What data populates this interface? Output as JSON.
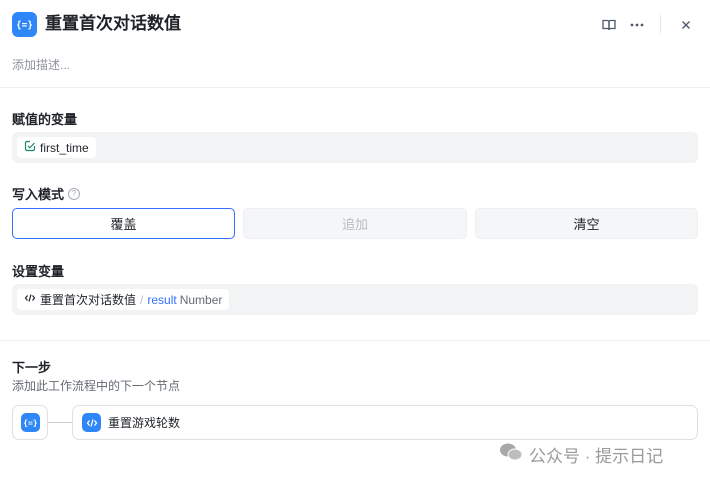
{
  "header": {
    "title": "重置首次对话数值",
    "icon": "variable-assign-icon",
    "description_placeholder": "添加描述..."
  },
  "assigned_variable": {
    "label": "赋值的变量",
    "chip_icon": "variable-icon",
    "value": "first_time"
  },
  "write_mode": {
    "label": "写入模式",
    "help_icon": "question-circle-icon",
    "options": [
      "覆盖",
      "追加",
      "清空"
    ],
    "selected": "覆盖",
    "disabled": [
      "追加"
    ]
  },
  "set_variable": {
    "label": "设置变量",
    "chip_icon": "code-icon",
    "node_name": "重置首次对话数值",
    "separator": "/",
    "output_name": "result",
    "output_type": "Number"
  },
  "next_step": {
    "title": "下一步",
    "subtitle": "添加此工作流程中的下一个节点",
    "next_node_label": "重置游戏轮数"
  },
  "watermark": {
    "text": "公众号 · 提示日记",
    "icon": "wechat-icon"
  },
  "colors": {
    "accent": "#2f86f6",
    "selected_border": "#3370ff",
    "field_bg": "#f2f3f5"
  }
}
